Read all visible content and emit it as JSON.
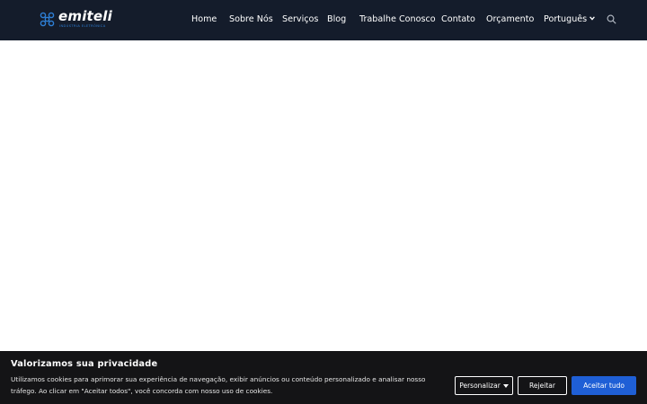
{
  "brand": {
    "name": "emiteli",
    "tagline": "indústria eletrônica",
    "accent": "#2e7fd6"
  },
  "nav": {
    "items": [
      {
        "label": "Home"
      },
      {
        "label": "Sobre Nós"
      },
      {
        "label": "Serviços"
      },
      {
        "label": "Blog"
      },
      {
        "label": "Trabalhe Conosco"
      },
      {
        "label": "Contato"
      },
      {
        "label": "Orçamento"
      },
      {
        "label": "Português",
        "has_dropdown": true
      }
    ],
    "search_icon": "search-icon"
  },
  "cookie": {
    "title": "Valorizamos sua privacidade",
    "text": "Utilizamos cookies para aprimorar sua experiência de navegação, exibir anúncios ou conteúdo personalizado e analisar nosso tráfego. Ao clicar em \"Aceitar todos\", você concorda com nosso uso de cookies.",
    "customize_label": "Personalizar",
    "reject_label": "Rejeitar",
    "accept_label": "Aceitar tudo",
    "accept_color": "#1f5fd6"
  },
  "colors": {
    "header_bg": "#141c2b",
    "banner_bg": "#141416"
  }
}
